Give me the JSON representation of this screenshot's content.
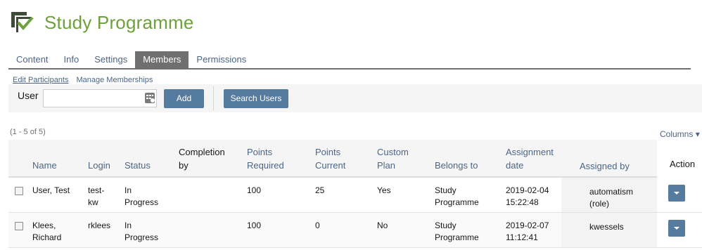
{
  "header": {
    "title": "Study Programme",
    "logo_icon": "study-programme-icon"
  },
  "tabs": [
    {
      "label": "Content",
      "active": false
    },
    {
      "label": "Info",
      "active": false
    },
    {
      "label": "Settings",
      "active": false
    },
    {
      "label": "Members",
      "active": true
    },
    {
      "label": "Permissions",
      "active": false
    }
  ],
  "subtabs": [
    {
      "label": "Edit Participants",
      "active": true
    },
    {
      "label": "Manage Memberships",
      "active": false
    }
  ],
  "toolbar": {
    "user_label": "User",
    "user_value": "",
    "add_label": "Add",
    "search_label": "Search Users"
  },
  "table": {
    "count": "(1 - 5 of 5)",
    "columns_label": "Columns",
    "headers": {
      "name": "Name",
      "login": "Login",
      "status": "Status",
      "completion_1": "Completion",
      "completion_2": "by",
      "points_req_1": "Points",
      "points_req_2": "Required",
      "points_cur_1": "Points",
      "points_cur_2": "Current",
      "custom_1": "Custom",
      "custom_2": "Plan",
      "belongs": "Belongs to",
      "assign_date_1": "Assignment",
      "assign_date_2": "date",
      "assigned_by": "Assigned by",
      "action": "Action"
    },
    "rows": [
      {
        "name_1": "User, Test",
        "name_2": "",
        "login_1": "test-",
        "login_2": "kw",
        "status_1": "In",
        "status_2": "Progress",
        "completion": "",
        "points_required": "100",
        "points_current": "25",
        "custom_plan": "Yes",
        "belongs_1": "Study",
        "belongs_2": "Programme",
        "date_1": "2019-02-04",
        "date_2": "15:22:48",
        "assigned_1": "automatism",
        "assigned_2": "(role)"
      },
      {
        "name_1": "Klees,",
        "name_2": "Richard",
        "login_1": "rklees",
        "login_2": "",
        "status_1": "In",
        "status_2": "Progress",
        "completion": "",
        "points_required": "100",
        "points_current": "0",
        "custom_plan": "No",
        "belongs_1": "Study",
        "belongs_2": "Programme",
        "date_1": "2019-02-07",
        "date_2": "11:12:41",
        "assigned_1": "kwessels",
        "assigned_2": ""
      }
    ]
  }
}
